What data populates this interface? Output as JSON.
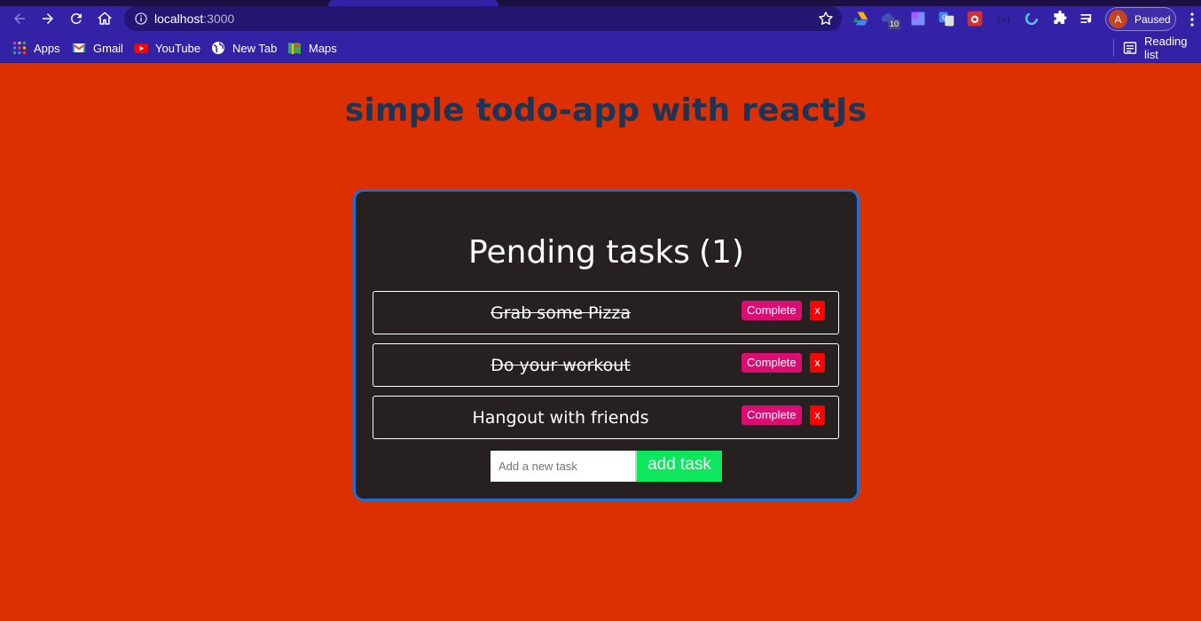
{
  "browser": {
    "url_host": "localhost",
    "url_port": ":3000",
    "extension_badge": "10",
    "profile_initial": "A",
    "profile_status": "Paused"
  },
  "bookmarks": [
    {
      "label": "Apps",
      "icon": "apps-grid-icon"
    },
    {
      "label": "Gmail",
      "icon": "gmail-icon"
    },
    {
      "label": "YouTube",
      "icon": "youtube-icon"
    },
    {
      "label": "New Tab",
      "icon": "globe-icon"
    },
    {
      "label": "Maps",
      "icon": "maps-icon"
    }
  ],
  "reading_list": "Reading list",
  "page": {
    "title": "simple todo-app with reactJs"
  },
  "todo": {
    "heading": "Pending tasks",
    "pending_count": "(1)",
    "tasks": [
      {
        "text": "Grab some Pizza",
        "completed": true,
        "complete_label": "Complete",
        "delete_label": "x"
      },
      {
        "text": "Do your workout",
        "completed": true,
        "complete_label": "Complete",
        "delete_label": "x"
      },
      {
        "text": "Hangout with friends",
        "completed": false,
        "complete_label": "Complete",
        "delete_label": "x"
      }
    ],
    "input_placeholder": "Add a new task",
    "add_label": "add task"
  },
  "colors": {
    "page_bg": "#dc3000",
    "title": "#1b3558",
    "card_bg": "#262021",
    "card_border": "#1e6fcf",
    "complete_btn": "#dc0d72",
    "delete_btn": "#ff0000",
    "add_btn": "#0de65d",
    "browser_chrome": "#3422a6"
  }
}
